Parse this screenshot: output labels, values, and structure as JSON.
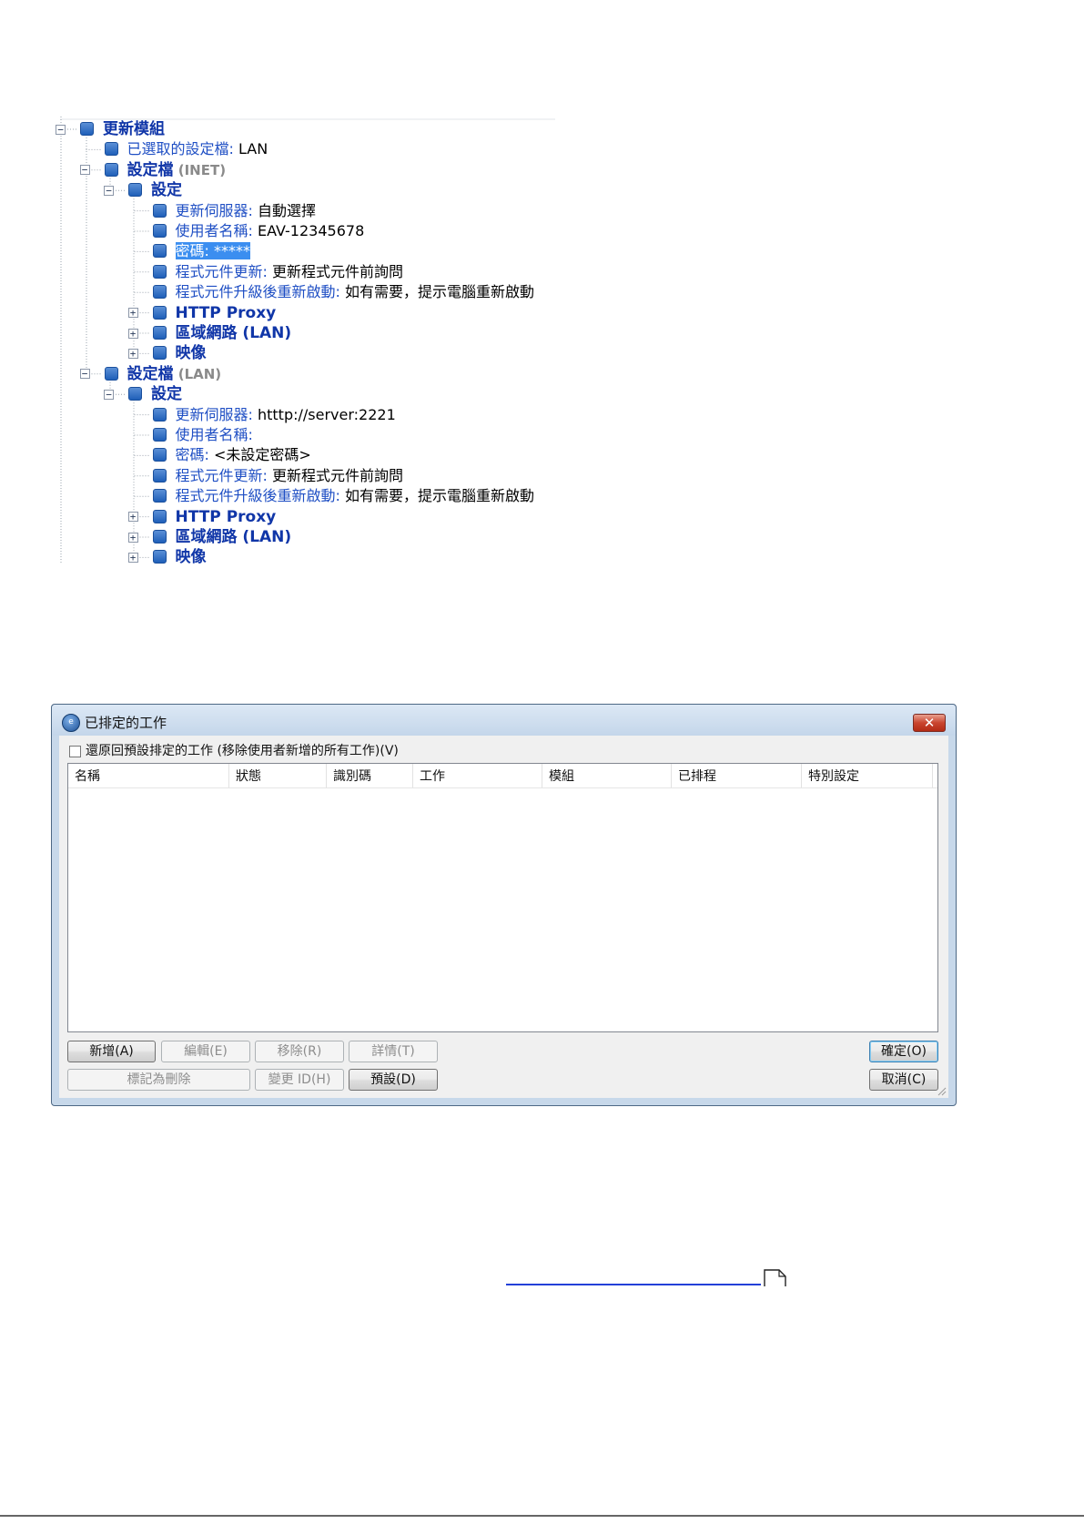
{
  "tree": {
    "nodes": [
      {
        "id": "n0",
        "label": "更新模組",
        "value": "",
        "suffix": "",
        "bold": true
      },
      {
        "id": "n1",
        "label": "已選取的設定檔:",
        "value": " LAN",
        "suffix": "",
        "bold": false
      },
      {
        "id": "n2",
        "label": "設定檔",
        "value": "",
        "suffix": " (INET)",
        "bold": true
      },
      {
        "id": "n3",
        "label": "設定",
        "value": "",
        "suffix": "",
        "bold": true
      },
      {
        "id": "n4",
        "label": "更新伺服器:",
        "value": " 自動選擇",
        "suffix": "",
        "bold": false
      },
      {
        "id": "n5",
        "label": "使用者名稱:",
        "value": " EAV-12345678",
        "suffix": "",
        "bold": false
      },
      {
        "id": "n6",
        "label": "密碼:",
        "value": " *****",
        "suffix": "",
        "bold": false,
        "selected": true
      },
      {
        "id": "n7",
        "label": "程式元件更新:",
        "value": " 更新程式元件前詢問",
        "suffix": "",
        "bold": false
      },
      {
        "id": "n8",
        "label": "程式元件升級後重新啟動:",
        "value": " 如有需要，提示電腦重新啟動",
        "suffix": "",
        "bold": false
      },
      {
        "id": "n9",
        "label": "HTTP Proxy",
        "value": "",
        "suffix": "",
        "bold": true
      },
      {
        "id": "n10",
        "label": "區域網路 (LAN)",
        "value": "",
        "suffix": "",
        "bold": true
      },
      {
        "id": "n11",
        "label": "映像",
        "value": "",
        "suffix": "",
        "bold": true
      },
      {
        "id": "n12",
        "label": "設定檔",
        "value": "",
        "suffix": " (LAN)",
        "bold": true
      },
      {
        "id": "n13",
        "label": "設定",
        "value": "",
        "suffix": "",
        "bold": true
      },
      {
        "id": "n14",
        "label": "更新伺服器:",
        "value": " htttp://server:2221",
        "suffix": "",
        "bold": false
      },
      {
        "id": "n15",
        "label": "使用者名稱:",
        "value": "",
        "suffix": "",
        "bold": false
      },
      {
        "id": "n16",
        "label": "密碼:",
        "value": " <未設定密碼>",
        "suffix": "",
        "bold": false
      },
      {
        "id": "n17",
        "label": "程式元件更新:",
        "value": " 更新程式元件前詢問",
        "suffix": "",
        "bold": false
      },
      {
        "id": "n18",
        "label": "程式元件升級後重新啟動:",
        "value": " 如有需要，提示電腦重新啟動",
        "suffix": "",
        "bold": false
      },
      {
        "id": "n19",
        "label": "HTTP Proxy",
        "value": "",
        "suffix": "",
        "bold": true
      },
      {
        "id": "n20",
        "label": "區域網路 (LAN)",
        "value": "",
        "suffix": "",
        "bold": true
      },
      {
        "id": "n21",
        "label": "映像",
        "value": "",
        "suffix": "",
        "bold": true
      }
    ]
  },
  "dialog": {
    "title": "已排定的工作",
    "close_glyph": "✕",
    "restore_checkbox": {
      "label": "還原回預設排定的工作 (移除使用者新增的所有工作)(V)",
      "checked": false
    },
    "columns": [
      "名稱",
      "狀態",
      "識別碼",
      "工作",
      "模組",
      "已排程",
      "特別設定"
    ],
    "buttons": {
      "add": "新增(A)",
      "edit": "編輯(E)",
      "remove": "移除(R)",
      "details": "詳情(T)",
      "mark_delete": "標記為刪除",
      "change_id": "變更 ID(H)",
      "default": "預設(D)",
      "ok": "確定(O)",
      "cancel": "取消(C)"
    }
  },
  "colors": {
    "accent": "#1f4fc4",
    "selection": "#3b8ef0",
    "link": "#2340d8"
  }
}
